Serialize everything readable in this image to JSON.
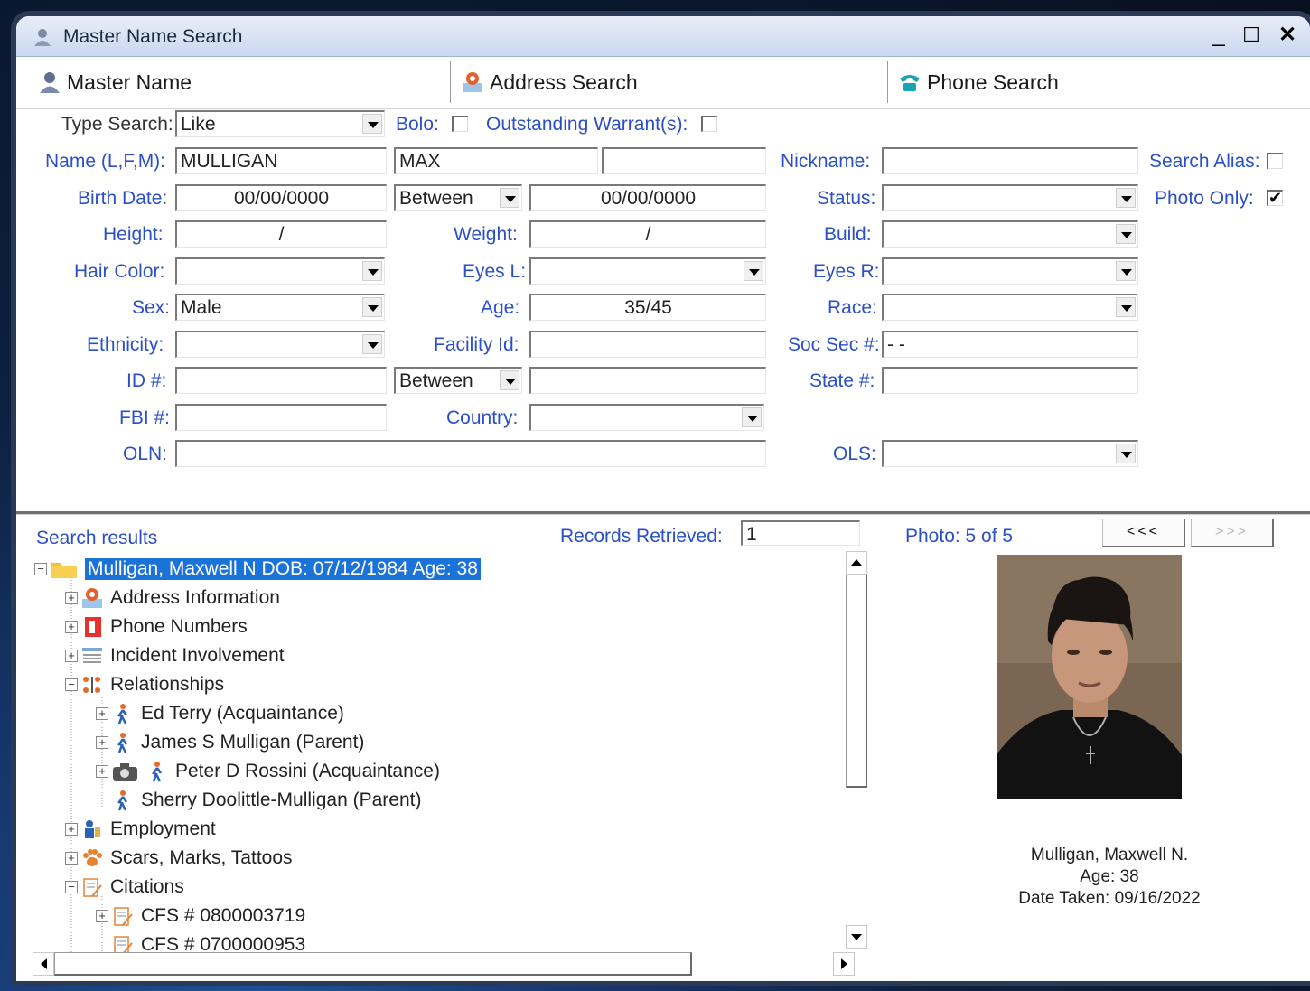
{
  "window": {
    "title": "Master Name Search",
    "minimize": "_",
    "maximize": "☐",
    "close": "✕"
  },
  "tabs": [
    {
      "label": "Master Name"
    },
    {
      "label": "Address Search"
    },
    {
      "label": "Phone Search"
    }
  ],
  "form": {
    "type_search_label": "Type Search:",
    "type_search_value": "Like",
    "bolo_label": "Bolo:",
    "bolo_checked": false,
    "warrant_label": "Outstanding Warrant(s):",
    "warrant_checked": false,
    "name_label": "Name (L,F,M):",
    "last_name": "MULLIGAN",
    "first_name": "MAX",
    "middle_name": "",
    "nickname_label": "Nickname:",
    "nickname_value": "",
    "search_alias_label": "Search Alias:",
    "search_alias_checked": false,
    "birth_date_label": "Birth Date:",
    "birth_date_from": "00/00/0000",
    "birth_date_op": "Between",
    "birth_date_to": "00/00/0000",
    "status_label": "Status:",
    "status_value": "",
    "photo_only_label": "Photo Only:",
    "photo_only_checked": "✔",
    "height_label": "Height:",
    "height_value": "/",
    "weight_label": "Weight:",
    "weight_value": "/",
    "build_label": "Build:",
    "build_value": "",
    "hair_label": "Hair Color:",
    "hair_value": "",
    "eyes_l_label": "Eyes L:",
    "eyes_l_value": "",
    "eyes_r_label": "Eyes R:",
    "eyes_r_value": "",
    "sex_label": "Sex:",
    "sex_value": "Male",
    "age_label": "Age:",
    "age_value": "35/45",
    "race_label": "Race:",
    "race_value": "",
    "ethnicity_label": "Ethnicity:",
    "ethnicity_value": "",
    "facility_label": "Facility Id:",
    "facility_value": "",
    "ssn_label": "Soc Sec #:",
    "ssn_value": " -  -",
    "id_label": "ID #:",
    "id_value": "",
    "id_op": "Between",
    "id_to": "",
    "state_label": "State #:",
    "state_value": "",
    "fbi_label": "FBI #:",
    "fbi_value": "",
    "country_label": "Country:",
    "country_value": "",
    "oln_label": "OLN:",
    "oln_value": "",
    "ols_label": "OLS:",
    "ols_value": ""
  },
  "results": {
    "header": "Search results",
    "records_label": "Records Retrieved:",
    "records_value": "1",
    "photo_label": "Photo: 5 of 5",
    "prev_label": "<<<",
    "next_label": ">>>",
    "tree": [
      {
        "label": "Mulligan,  Maxwell  N  DOB: 07/12/1984  Age: 38",
        "level": 0,
        "exp": "−",
        "icon": "folder-icon",
        "selected": true
      },
      {
        "label": "Address Information",
        "level": 1,
        "exp": "+",
        "icon": "address-icon"
      },
      {
        "label": "Phone Numbers",
        "level": 1,
        "exp": "+",
        "icon": "phone-book-icon"
      },
      {
        "label": "Incident Involvement",
        "level": 1,
        "exp": "+",
        "icon": "incident-icon"
      },
      {
        "label": "Relationships",
        "level": 1,
        "exp": "−",
        "icon": "relationships-icon"
      },
      {
        "label": "Ed  Terry    (Acquaintance)",
        "level": 2,
        "exp": "+",
        "icon": "person-icon"
      },
      {
        "label": "James  S  Mulligan    (Parent)",
        "level": 2,
        "exp": "+",
        "icon": "person-icon"
      },
      {
        "label": "Peter  D  Rossini    (Acquaintance)",
        "level": 2,
        "exp": "+",
        "icon": "person-camera-icon"
      },
      {
        "label": "Sherry  Doolittle-Mulligan    (Parent)",
        "level": 2,
        "exp": "",
        "icon": "person-icon"
      },
      {
        "label": "Employment",
        "level": 1,
        "exp": "+",
        "icon": "employment-icon"
      },
      {
        "label": "Scars, Marks, Tattoos",
        "level": 1,
        "exp": "+",
        "icon": "paw-icon"
      },
      {
        "label": "Citations",
        "level": 1,
        "exp": "−",
        "icon": "citation-icon"
      },
      {
        "label": "CFS # 0800003719",
        "level": 2,
        "exp": "+",
        "icon": "citation-icon"
      },
      {
        "label": "CFS # 0700000953",
        "level": 2,
        "exp": "",
        "icon": "citation-icon"
      }
    ]
  },
  "photo_caption": {
    "name": "Mulligan, Maxwell N.",
    "age": "Age: 38",
    "date": "Date Taken: 09/16/2022"
  }
}
